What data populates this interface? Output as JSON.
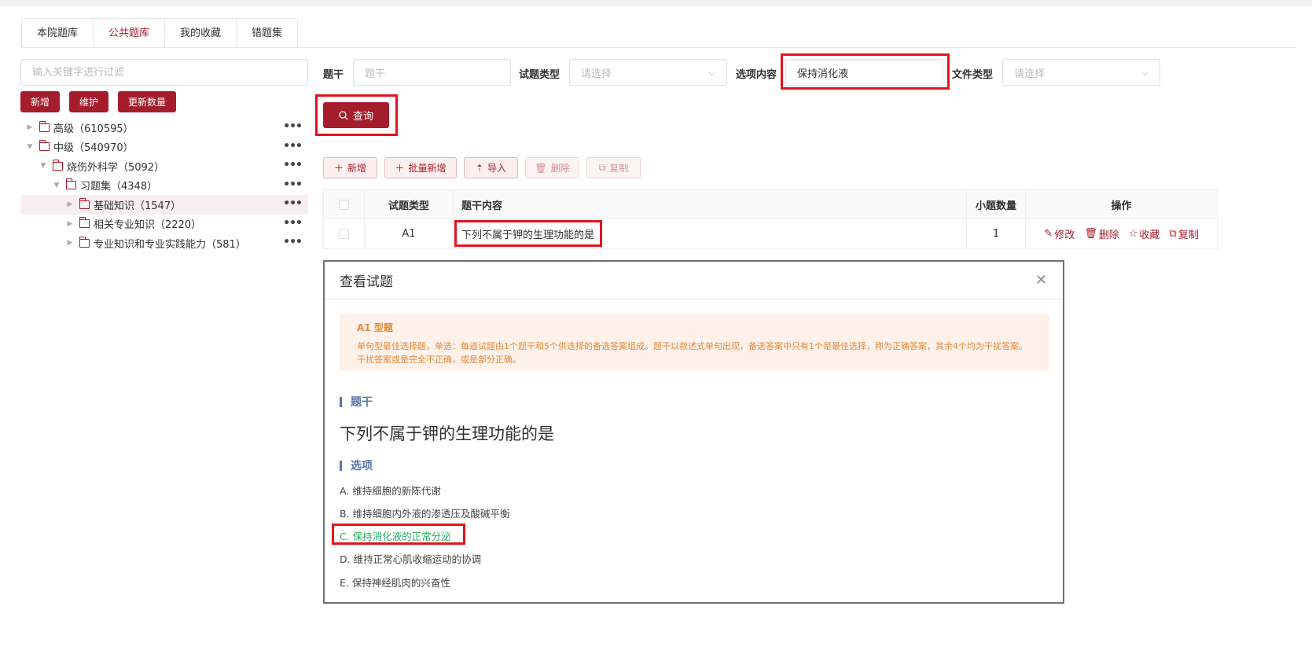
{
  "tabs": [
    {
      "label": "本院题库",
      "active": false
    },
    {
      "label": "公共题库",
      "active": true
    },
    {
      "label": "我的收藏",
      "active": false
    },
    {
      "label": "错题集",
      "active": false
    }
  ],
  "sidebar": {
    "filter_placeholder": "输入关键字进行过滤",
    "buttons": {
      "add": "新增",
      "maintain": "维护",
      "update_count": "更新数量"
    },
    "tree": [
      {
        "label": "高级（610595）",
        "level": 0,
        "expanded": false
      },
      {
        "label": "中级（540970）",
        "level": 0,
        "expanded": true
      },
      {
        "label": "烧伤外科学（5092）",
        "level": 1,
        "expanded": true
      },
      {
        "label": "习题集（4348）",
        "level": 2,
        "expanded": true
      },
      {
        "label": "基础知识（1547）",
        "level": 3,
        "expanded": false,
        "selected": true
      },
      {
        "label": "相关专业知识（2220）",
        "level": 3,
        "expanded": false
      },
      {
        "label": "专业知识和专业实践能力（581）",
        "level": 3,
        "expanded": false
      }
    ]
  },
  "search": {
    "stem_label": "题干",
    "stem_placeholder": "题干",
    "type_label": "试题类型",
    "type_placeholder": "请选择",
    "option_label": "选项内容",
    "option_value": "保持消化液",
    "file_label": "文件类型",
    "file_placeholder": "请选择",
    "query_button": "查询"
  },
  "toolbar": {
    "add": "新增",
    "batch_add": "批量新增",
    "import": "导入",
    "delete": "删除",
    "copy": "复制"
  },
  "table": {
    "headers": [
      "试题类型",
      "题干内容",
      "小题数量",
      "操作"
    ],
    "rows": [
      {
        "type": "A1",
        "stem": "下列不属于钾的生理功能的是",
        "count": "1"
      }
    ],
    "ops": {
      "edit": "修改",
      "delete": "删除",
      "favorite": "收藏",
      "copy": "复制"
    }
  },
  "modal": {
    "title": "查看试题",
    "info_title": "A1 型题",
    "info_text": "单句型最佳选择题，单选：每道试题由1个题干和5个供选择的备选答案组成。题干以叙述式单句出现，备选答案中只有1个是最佳选择，称为正确答案，其余4个均为干扰答案。干扰答案或是完全不正确，或是部分正确。",
    "stem_section": "题干",
    "stem_text": "下列不属于钾的生理功能的是",
    "options_section": "选项",
    "options": [
      {
        "text": "A. 维持细胞的新陈代谢",
        "correct": false
      },
      {
        "text": "B. 维持细胞内外液的渗透压及酸碱平衡",
        "correct": false
      },
      {
        "text": "C. 保持消化液的正常分泌",
        "correct": true
      },
      {
        "text": "D. 维持正常心肌收缩运动的协调",
        "correct": false
      },
      {
        "text": "E. 保持神经肌肉的兴奋性",
        "correct": false
      }
    ]
  },
  "colors": {
    "accent": "#a51d2d",
    "highlight": "#e0141e",
    "correct": "#27ae60",
    "info": "#e6893a",
    "section": "#5b75a8"
  }
}
